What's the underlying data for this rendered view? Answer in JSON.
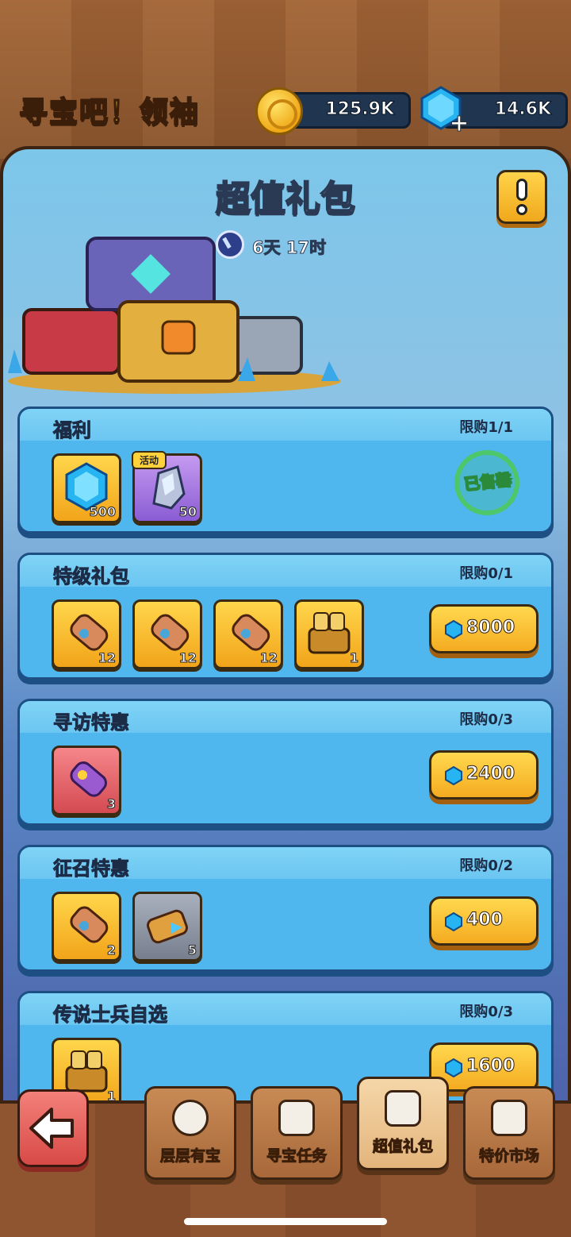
{
  "header": {
    "game_title": "寻宝吧！领袖",
    "coins": "125.9K",
    "gems": "14.6K"
  },
  "panel": {
    "title": "超值礼包",
    "timer": "6天 17时"
  },
  "packs": [
    {
      "name": "福利",
      "limit": "限购1/1",
      "items": [
        {
          "icon": "gem-icon",
          "qty": "500",
          "tag": ""
        },
        {
          "icon": "crystal-ore-icon",
          "qty": "50",
          "tag": "活动"
        }
      ],
      "status": "已售罄"
    },
    {
      "name": "特级礼包",
      "limit": "限购0/1",
      "items": [
        {
          "icon": "scroll-icon",
          "qty": "12"
        },
        {
          "icon": "scroll-icon",
          "qty": "12"
        },
        {
          "icon": "scroll-icon",
          "qty": "12"
        },
        {
          "icon": "hero-chest-icon",
          "qty": "1"
        }
      ],
      "price": "8000"
    },
    {
      "name": "寻访特惠",
      "limit": "限购0/3",
      "items": [
        {
          "icon": "purple-scroll-icon",
          "qty": "3"
        }
      ],
      "price": "2400"
    },
    {
      "name": "征召特惠",
      "limit": "限购0/2",
      "items": [
        {
          "icon": "scroll-icon",
          "qty": "2"
        },
        {
          "icon": "recruit-scroll-icon",
          "qty": "5"
        }
      ],
      "price": "400"
    },
    {
      "name": "传说士兵自选",
      "limit": "限购0/3",
      "items": [
        {
          "icon": "hero-chest-icon",
          "qty": "1"
        }
      ],
      "price": "1600"
    }
  ],
  "nav": {
    "tab1": "层层有宝",
    "tab2": "寻宝任务",
    "tab3": "超值礼包",
    "tab4": "特价市场"
  },
  "colors": {
    "gold": "#f4ab21",
    "card_blue": "#4fb6ee",
    "soldout_green": "#4ec76a"
  }
}
